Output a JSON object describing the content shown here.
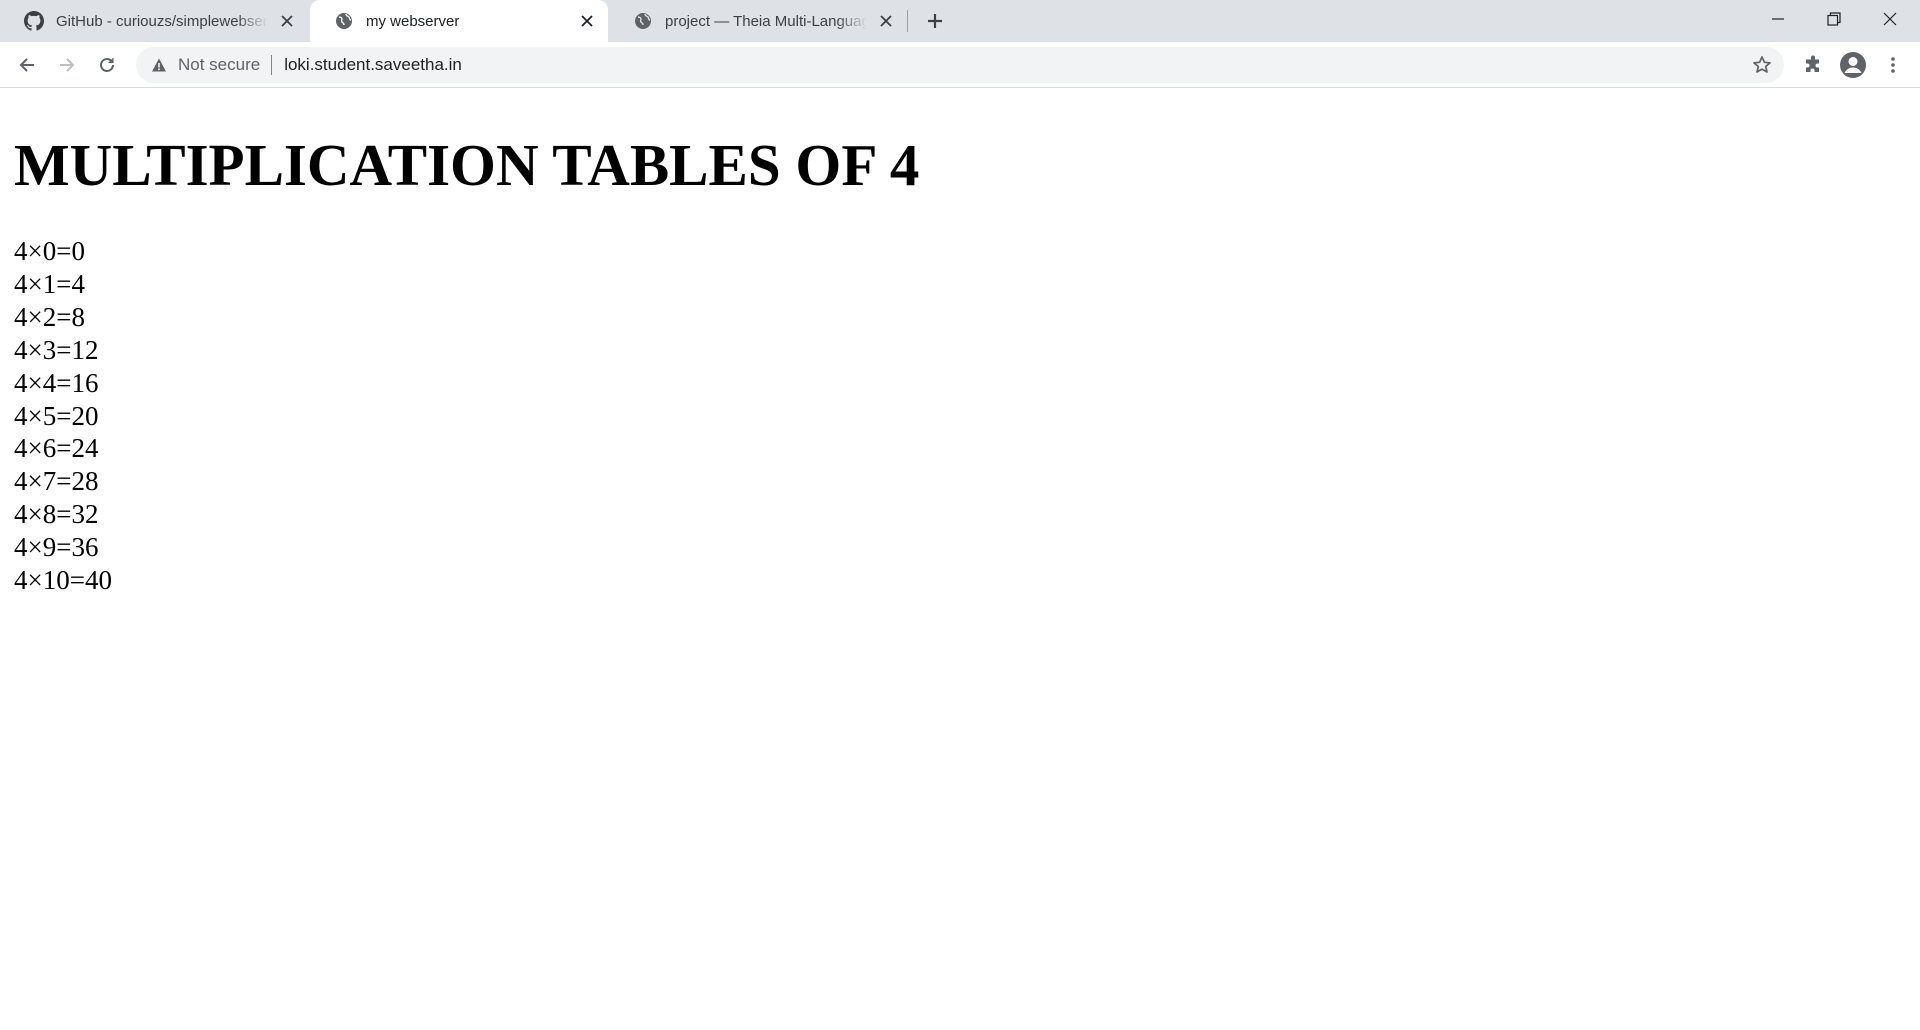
{
  "browser": {
    "tabs": [
      {
        "title": "GitHub - curiouzs/simplewebserver",
        "icon": "github-icon",
        "active": false
      },
      {
        "title": "my webserver",
        "icon": "globe-icon",
        "active": true
      },
      {
        "title": "project — Theia Multi-Language Workspace",
        "icon": "globe-icon",
        "active": false
      }
    ],
    "address_bar": {
      "security_label": "Not secure",
      "url": "loki.student.saveetha.in"
    }
  },
  "page": {
    "heading": "MULTIPLICATION TABLES OF 4",
    "lines": [
      "4×0=0",
      "4×1=4",
      "4×2=8",
      "4×3=12",
      "4×4=16",
      "4×5=20",
      "4×6=24",
      "4×7=28",
      "4×8=32",
      "4×9=36",
      "4×10=40"
    ]
  },
  "colors": {
    "tabstrip_bg": "#dee1e6",
    "omnibox_bg": "#f1f3f4",
    "icon_color": "#5f6368"
  }
}
